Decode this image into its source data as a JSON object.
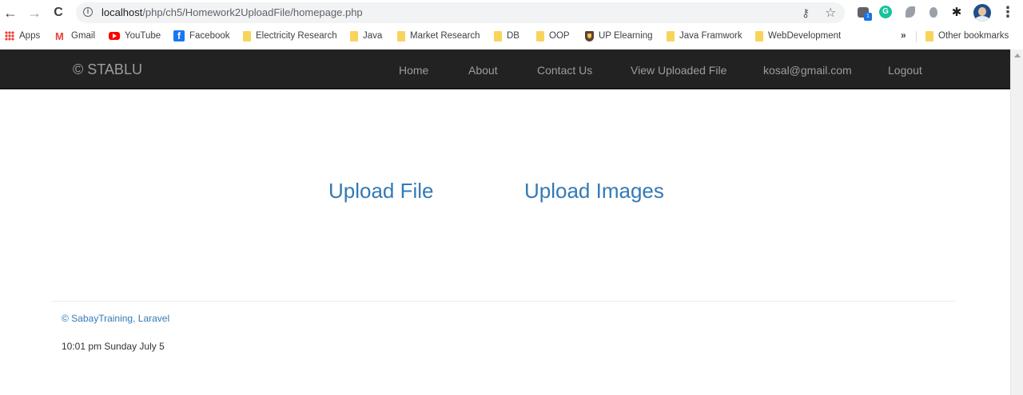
{
  "browser": {
    "url_host": "localhost",
    "url_path": "/php/ch5/Homework2UploadFile/homepage.php",
    "back_icon": "←",
    "forward_icon": "→",
    "reload_icon": "C",
    "info_icon": "i",
    "key_icon": "⚷",
    "star_icon": "☆",
    "menu_icon": "⋮",
    "extension_badge": "1",
    "grammarly_icon": "G",
    "puzzle_icon": "✱"
  },
  "bookmarks": {
    "items": [
      {
        "label": "Apps",
        "icon": "apps-grid-icon"
      },
      {
        "label": "Gmail",
        "icon": "gmail-icon"
      },
      {
        "label": "YouTube",
        "icon": "youtube-icon"
      },
      {
        "label": "Facebook",
        "icon": "facebook-icon"
      },
      {
        "label": "Electricity Research",
        "icon": "folder-icon"
      },
      {
        "label": "Java",
        "icon": "folder-icon"
      },
      {
        "label": "Market Research",
        "icon": "folder-icon"
      },
      {
        "label": "DB",
        "icon": "folder-icon"
      },
      {
        "label": "OOP",
        "icon": "folder-icon"
      },
      {
        "label": "UP Elearning",
        "icon": "shield-icon"
      },
      {
        "label": "Java Framwork",
        "icon": "folder-icon"
      },
      {
        "label": "WebDevelopment",
        "icon": "folder-icon"
      }
    ],
    "gmail_glyph": "M",
    "facebook_glyph": "f",
    "more_label": "»",
    "other_bookmarks": "Other bookmarks"
  },
  "navbar": {
    "brand": "© STABLU",
    "links": [
      "Home",
      "About",
      "Contact Us",
      "View Uploaded File",
      "kosal@gmail.com",
      "Logout"
    ]
  },
  "main": {
    "upload_file": "Upload File",
    "upload_images": "Upload Images"
  },
  "footer": {
    "credit": "© SabayTraining, Laravel",
    "timestamp": "10:01 pm Sunday July 5"
  },
  "colors": {
    "navbar_bg": "#222222",
    "navbar_text": "#9d9d9d",
    "link": "#337ab7"
  }
}
